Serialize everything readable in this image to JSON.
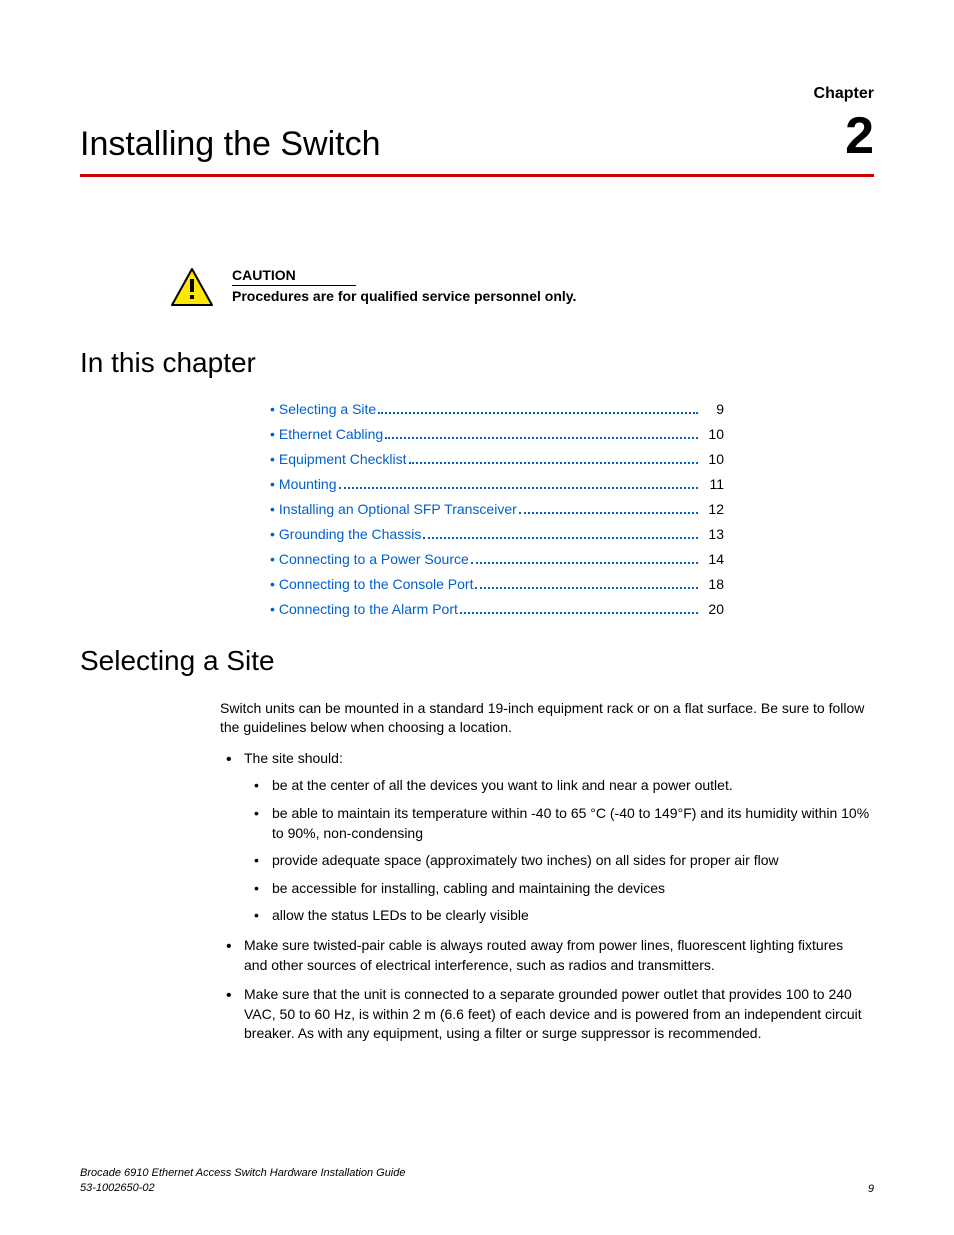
{
  "header": {
    "chapter_label": "Chapter",
    "chapter_number": "2",
    "main_title": "Installing the Switch"
  },
  "caution": {
    "heading": "CAUTION",
    "body": "Procedures are for qualified service personnel only."
  },
  "toc": {
    "heading": "In this chapter",
    "items": [
      {
        "label": "Selecting a Site",
        "page": "9"
      },
      {
        "label": "Ethernet Cabling",
        "page": "10"
      },
      {
        "label": "Equipment Checklist",
        "page": "10"
      },
      {
        "label": "Mounting",
        "page": "11"
      },
      {
        "label": "Installing an Optional SFP Transceiver",
        "page": "12"
      },
      {
        "label": "Grounding the Chassis",
        "page": "13"
      },
      {
        "label": "Connecting to a Power Source",
        "page": "14"
      },
      {
        "label": "Connecting to the Console Port",
        "page": "18"
      },
      {
        "label": "Connecting to the Alarm Port",
        "page": "20"
      }
    ]
  },
  "section": {
    "heading": "Selecting a Site",
    "intro": "Switch units can be mounted in a standard 19-inch equipment rack or on a flat surface. Be sure to follow the guidelines below when choosing a location.",
    "bullets": {
      "site_should": "The site should:",
      "sub": [
        "be at the center of all the devices you want to link and near a power outlet.",
        "be able to maintain its temperature within -40 to 65 °C (-40 to 149°F) and its humidity within 10% to 90%, non-condensing",
        "provide adequate space (approximately two inches) on all sides for proper air flow",
        "be accessible for installing, cabling and maintaining the devices",
        "allow the status LEDs to be clearly visible"
      ],
      "twisted_pair": "Make sure twisted-pair cable is always routed away from power lines, fluorescent lighting fixtures and other sources of electrical interference, such as radios and transmitters.",
      "grounded": "Make sure that the unit is connected to a separate grounded power outlet that provides 100 to 240 VAC, 50 to 60 Hz, is within 2 m (6.6 feet) of each device and is powered from an independent circuit breaker. As with any equipment, using a filter or surge suppressor is recommended."
    }
  },
  "footer": {
    "title": "Brocade 6910 Ethernet Access Switch Hardware Installation Guide",
    "docnum": "53-1002650-02",
    "page": "9"
  }
}
